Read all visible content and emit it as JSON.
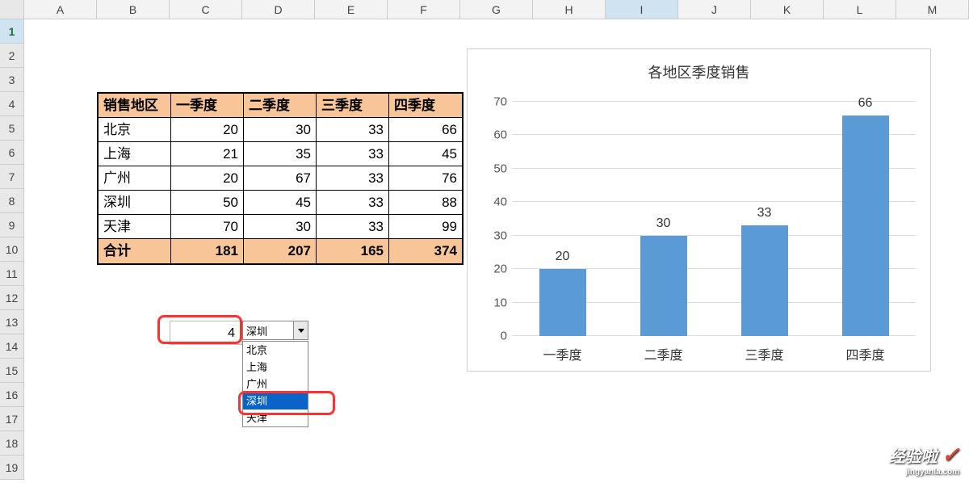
{
  "columns": [
    "A",
    "B",
    "C",
    "D",
    "E",
    "F",
    "G",
    "H",
    "I",
    "J",
    "K",
    "L",
    "M"
  ],
  "rows": [
    "1",
    "2",
    "3",
    "4",
    "5",
    "6",
    "7",
    "8",
    "9",
    "10",
    "11",
    "12",
    "13",
    "14",
    "15",
    "16",
    "17",
    "18",
    "19"
  ],
  "selected_col_index": 8,
  "selected_row_index": 0,
  "table": {
    "headers": [
      "销售地区",
      "一季度",
      "二季度",
      "三季度",
      "四季度"
    ],
    "rows": [
      {
        "label": "北京",
        "values": [
          "20",
          "30",
          "33",
          "66"
        ]
      },
      {
        "label": "上海",
        "values": [
          "21",
          "35",
          "33",
          "45"
        ]
      },
      {
        "label": "广州",
        "values": [
          "20",
          "67",
          "33",
          "76"
        ]
      },
      {
        "label": "深圳",
        "values": [
          "50",
          "45",
          "33",
          "88"
        ]
      },
      {
        "label": "天津",
        "values": [
          "70",
          "30",
          "33",
          "99"
        ]
      }
    ],
    "total": {
      "label": "合计",
      "values": [
        "181",
        "207",
        "165",
        "374"
      ]
    }
  },
  "link_cell": {
    "value": "4"
  },
  "combo": {
    "selected": "深圳",
    "options": [
      "北京",
      "上海",
      "广州",
      "深圳",
      "天津"
    ],
    "highlighted_index": 3
  },
  "chart_data": {
    "type": "bar",
    "title": "各地区季度销售",
    "categories": [
      "一季度",
      "二季度",
      "三季度",
      "四季度"
    ],
    "values": [
      20,
      30,
      33,
      66
    ],
    "data_labels": [
      "20",
      "30",
      "33",
      "66"
    ],
    "ylim": [
      0,
      70
    ],
    "yticks": [
      0,
      10,
      20,
      30,
      40,
      50,
      60,
      70
    ],
    "xlabel": "",
    "ylabel": ""
  },
  "watermark": {
    "text": "经验啦",
    "sub": "jingyanla.com"
  }
}
